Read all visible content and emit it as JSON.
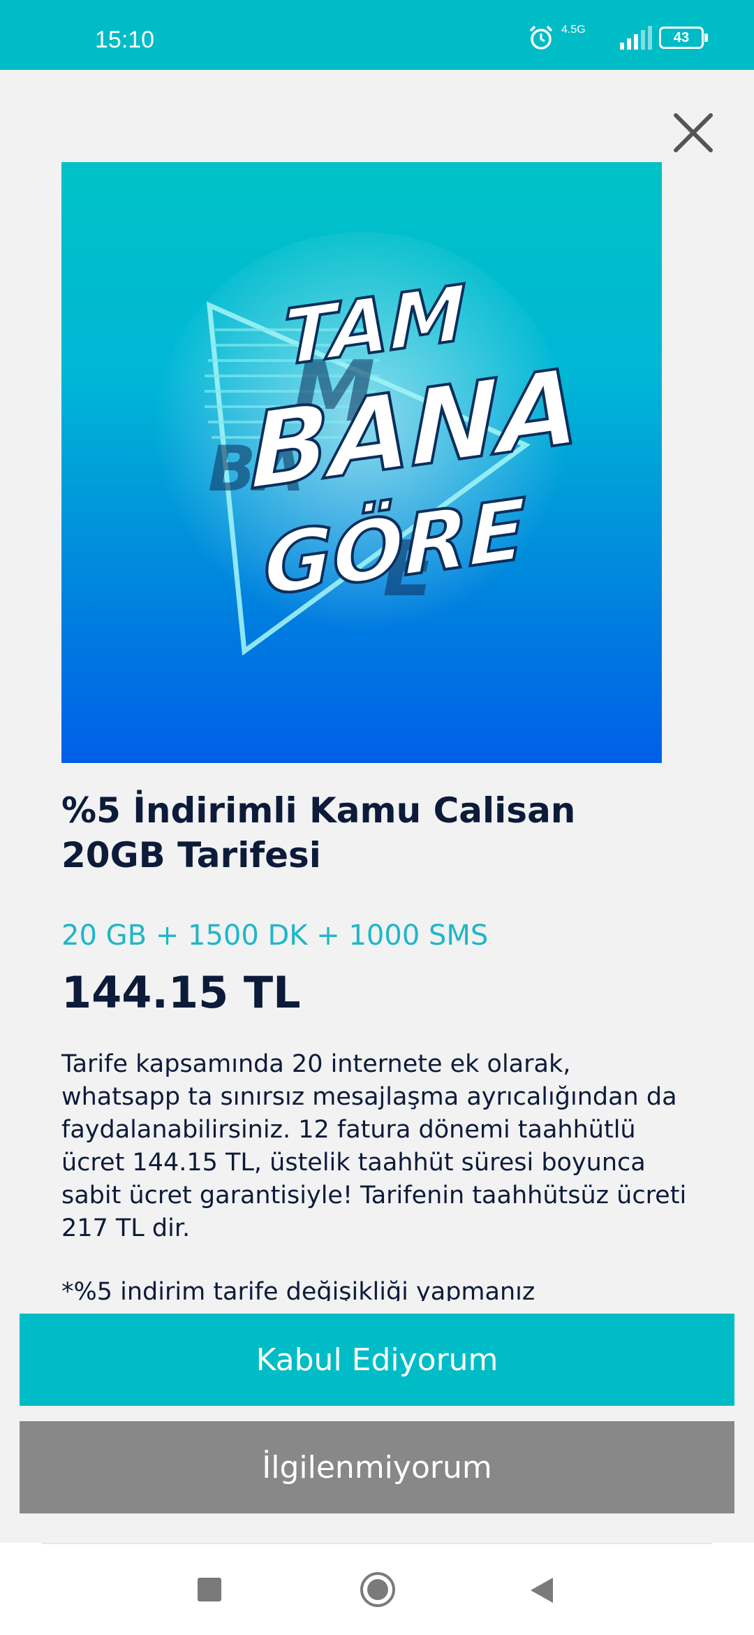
{
  "status_bar": {
    "time": "15:10",
    "network": "4.5G",
    "battery": "43"
  },
  "hero_image": {
    "line1": "TAM",
    "line2": "BANA",
    "line3": "GÖRE"
  },
  "offer": {
    "title_line1": "%5 İndirimli Kamu Calisan",
    "title_line2": "20GB Tarifesi",
    "features": "20 GB + 1500 DK + 1000 SMS",
    "price": "144.15 TL",
    "description": "Tarife kapsamında 20 internete ek olarak, whatsapp ta sınırsız mesajlaşma ayrıcalığından da faydalanabilirsiniz. 12 fatura dönemi taahhütlü ücret 144.15 TL, üstelik taahhüt süresi boyunca sabit ücret garantisiyle! Tarifenin taahhütsüz ücreti 217 TL dir.",
    "note": "*%5 indirim tarife değişikliği yapmanız"
  },
  "buttons": {
    "accept_label": "Kabul Ediyorum",
    "decline_label": "İlgilenmiyorum"
  },
  "colors": {
    "brand": "#00bcc6",
    "decline": "#888888",
    "text_dark": "#0d1b3a",
    "features_text": "#1fb6c8"
  }
}
